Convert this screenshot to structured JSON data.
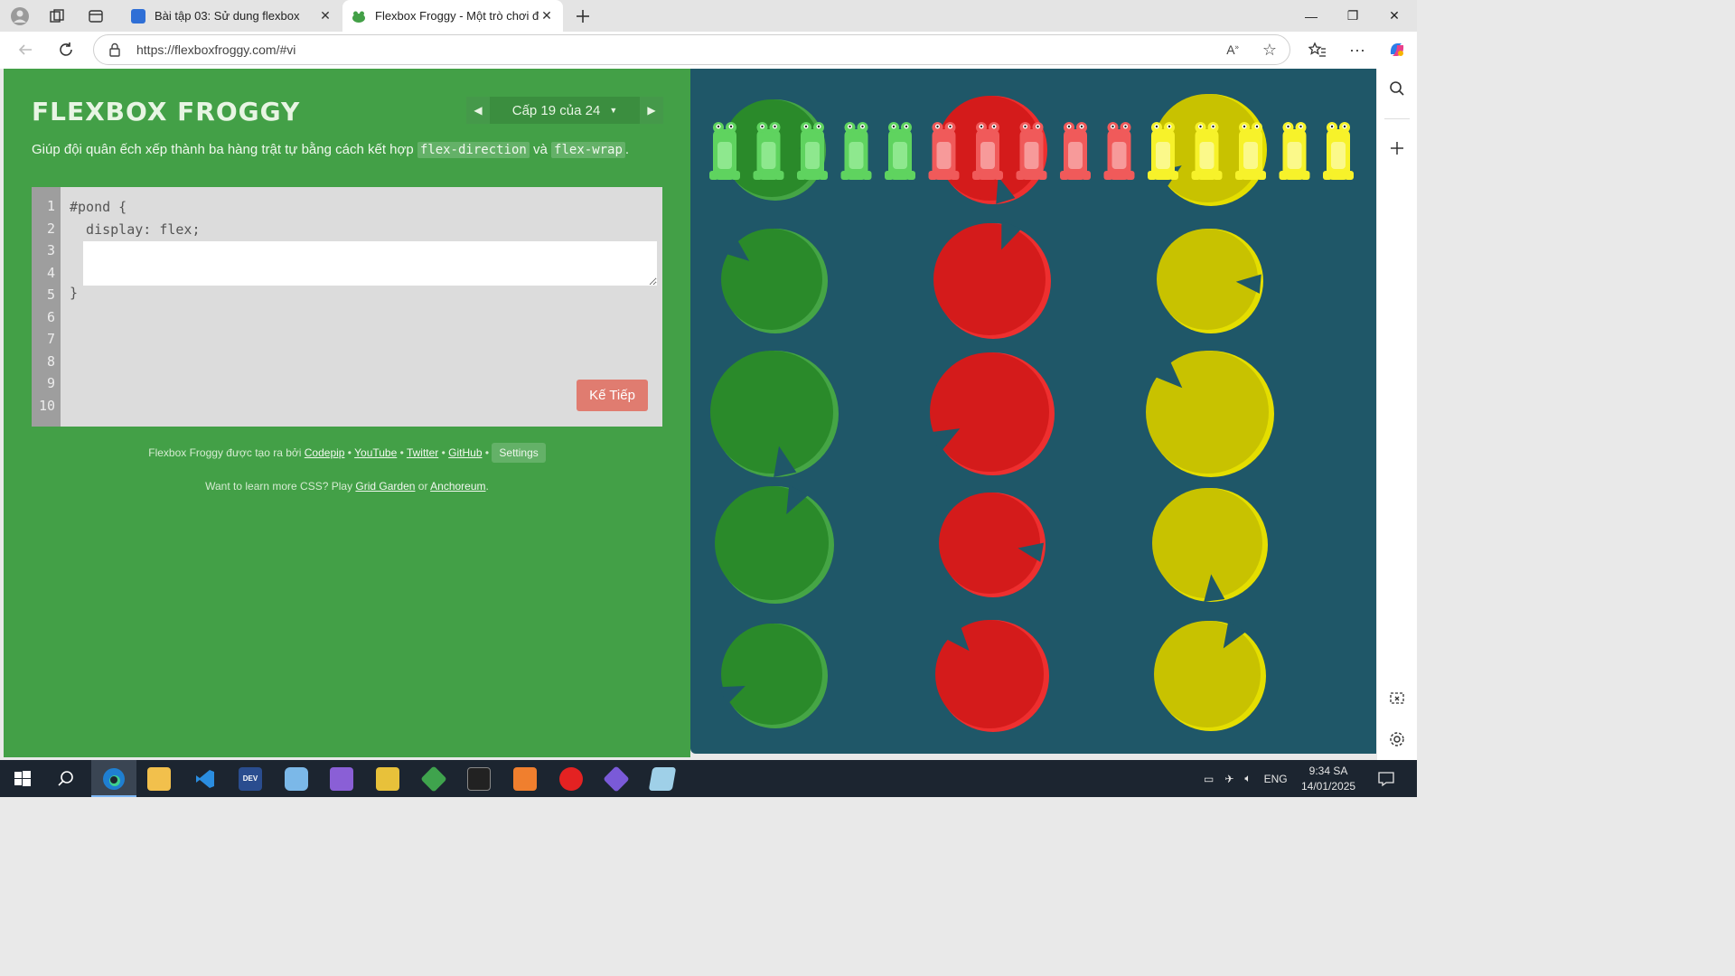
{
  "browser": {
    "tabs": [
      {
        "title": "Bài tập 03: Sử dung flexbox",
        "favicon_color": "#2f6fd6"
      },
      {
        "title": "Flexbox Froggy - Một trò chơi để",
        "favicon_color": "#43a047"
      }
    ],
    "url": "https://flexboxfroggy.com/#vi"
  },
  "page": {
    "logo": "FLEXBOX FROGGY",
    "level_label": "Cấp 19 của 24",
    "instruction_prefix": "Giúp đội quân ếch xếp thành ba hàng trật tự bằng cách kết hợp ",
    "instruction_code1": "flex-direction",
    "instruction_middle": " và ",
    "instruction_code2": "flex-wrap",
    "instruction_suffix": ".",
    "line_numbers": [
      "1",
      "2",
      "3",
      "4",
      "5",
      "6",
      "7",
      "8",
      "9",
      "10"
    ],
    "code_line1": "#pond {",
    "code_line2": "  display: flex;",
    "code_line_close": "}",
    "css_input_value": "",
    "next_button": "Kế Tiếp",
    "credits_prefix": "Flexbox Froggy được tạo ra bởi ",
    "credits_links": [
      "Codepip",
      "YouTube",
      "Twitter",
      "GitHub"
    ],
    "settings_label": "Settings",
    "learn_prefix": "Want to learn more CSS? Play ",
    "learn_link1": "Grid Garden",
    "learn_or": " or ",
    "learn_link2": "Anchoreum",
    "learn_suffix": "."
  },
  "colors": {
    "left_panel": "#43a047",
    "pond": "#1f5768",
    "green_pad": "#2a8a2a",
    "red_pad": "#d41b1b",
    "yellow_pad": "#c8c200",
    "green_frog": "#5fd35f",
    "red_frog": "#f05a5a",
    "yellow_frog": "#f7f22a"
  },
  "pond": {
    "frogs": [
      "green",
      "green",
      "green",
      "green",
      "green",
      "red",
      "red",
      "red",
      "red",
      "red",
      "yellow",
      "yellow",
      "yellow",
      "yellow",
      "yellow"
    ],
    "lilypads": [
      "green",
      "red",
      "yellow",
      "green",
      "red",
      "yellow",
      "green",
      "red",
      "yellow",
      "green",
      "red",
      "yellow",
      "green",
      "red",
      "yellow"
    ]
  },
  "taskbar": {
    "language": "ENG",
    "time": "9:34 SA",
    "date": "14/01/2025"
  }
}
